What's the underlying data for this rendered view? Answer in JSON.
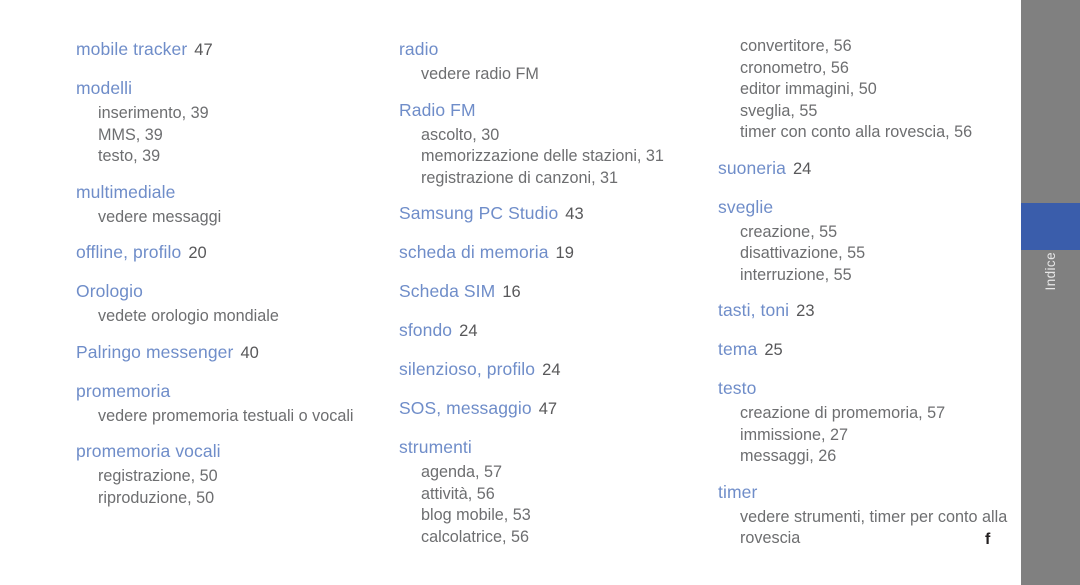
{
  "document": {
    "kind": "index-page",
    "folio": "f",
    "language": "it"
  },
  "side_rail": {
    "tab_label": "Indice",
    "rail_color": "#808080",
    "active_tab_color": "#3a5dab",
    "label_color": "#e6e6e6"
  },
  "theme": {
    "headword_color": "#6f8dc9",
    "subentry_color": "#6d6e70",
    "page_number_color": "#58585a",
    "background": "#ffffff"
  },
  "columns": [
    {
      "id": "column-1",
      "groups": [
        {
          "headword": "mobile tracker",
          "page": "47",
          "subentries": []
        },
        {
          "headword": "modelli",
          "page": "",
          "subentries": [
            "inserimento,  39",
            "MMS,  39",
            "testo,  39"
          ]
        },
        {
          "headword": "multimediale",
          "page": "",
          "subentries": [
            "vedere messaggi"
          ]
        },
        {
          "headword": "offline, profilo",
          "page": "20",
          "subentries": []
        },
        {
          "headword": "Orologio",
          "page": "",
          "subentries": [
            "vedete orologio mondiale"
          ]
        },
        {
          "headword": "Palringo messenger",
          "page": "40",
          "subentries": []
        },
        {
          "headword": "promemoria",
          "page": "",
          "subentries": [
            "vedere promemoria testuali o vocali"
          ]
        },
        {
          "headword": "promemoria vocali",
          "page": "",
          "subentries": [
            "registrazione,  50",
            "riproduzione,  50"
          ]
        }
      ]
    },
    {
      "id": "column-2",
      "groups": [
        {
          "headword": "radio",
          "page": "",
          "subentries": [
            "vedere radio FM"
          ]
        },
        {
          "headword": "Radio FM",
          "page": "",
          "subentries": [
            "ascolto,  30",
            "memorizzazione delle stazioni,  31",
            "registrazione di canzoni,  31"
          ]
        },
        {
          "headword": "Samsung PC Studio",
          "page": "43",
          "subentries": []
        },
        {
          "headword": "scheda di memoria",
          "page": "19",
          "subentries": []
        },
        {
          "headword": "Scheda SIM",
          "page": "16",
          "subentries": []
        },
        {
          "headword": "sfondo",
          "page": "24",
          "subentries": []
        },
        {
          "headword": "silenzioso, profilo",
          "page": "24",
          "subentries": []
        },
        {
          "headword": "SOS, messaggio",
          "page": "47",
          "subentries": []
        },
        {
          "headword": "strumenti",
          "page": "",
          "subentries": [
            "agenda,  57",
            "attività,  56",
            "blog mobile,  53",
            "calcolatrice,  56"
          ]
        }
      ]
    },
    {
      "id": "column-3",
      "groups": [
        {
          "headword": "",
          "page": "",
          "continuation": true,
          "subentries": [
            "convertitore,  56",
            "cronometro,  56",
            "editor immagini,  50",
            "sveglia,  55",
            "timer con conto alla rovescia,  56"
          ]
        },
        {
          "headword": "suoneria",
          "page": "24",
          "subentries": []
        },
        {
          "headword": "sveglie",
          "page": "",
          "subentries": [
            "creazione,  55",
            "disattivazione,  55",
            "interruzione,  55"
          ]
        },
        {
          "headword": "tasti, toni",
          "page": "23",
          "subentries": []
        },
        {
          "headword": "tema",
          "page": "25",
          "subentries": []
        },
        {
          "headword": "testo",
          "page": "",
          "subentries": [
            "creazione di promemoria,  57",
            "immissione,  27",
            "messaggi,  26"
          ]
        },
        {
          "headword": "timer",
          "page": "",
          "subentries": [
            "vedere strumenti, timer per conto alla rovescia"
          ]
        }
      ]
    }
  ]
}
